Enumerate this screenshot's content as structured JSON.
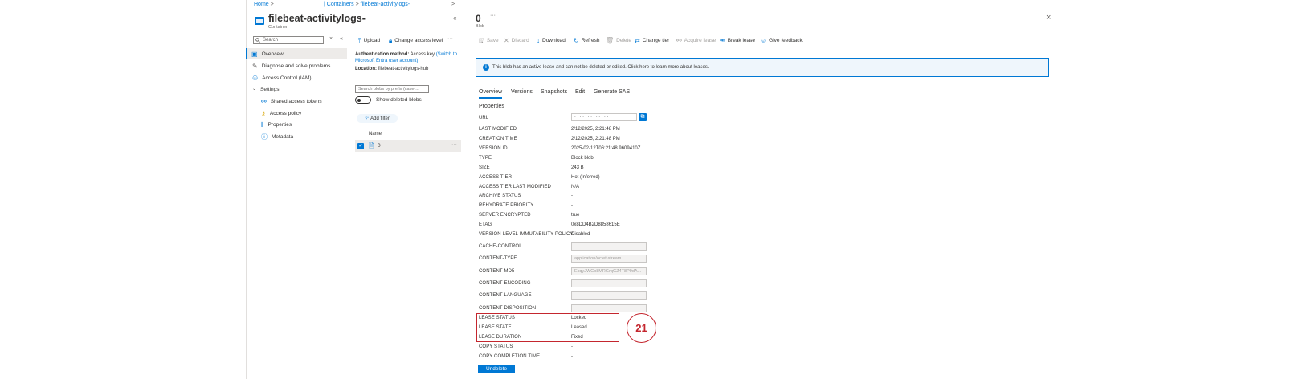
{
  "breadcrumb": {
    "home": "Home",
    "sep1": ">",
    "containers": "| Containers",
    "sep2": ">",
    "current": "filebeat-activitylogs-",
    "sep3": ">"
  },
  "container": {
    "title": "filebeat-activitylogs-",
    "subtitle": "Container",
    "collapse": "«",
    "search_placeholder": "Search",
    "search_clear": "×",
    "search_collapse": "«"
  },
  "left_nav": {
    "overview": "Overview",
    "diagnose": "Diagnose and solve problems",
    "iam": "Access Control (IAM)",
    "settings": "Settings",
    "sas": "Shared access tokens",
    "policy": "Access policy",
    "properties": "Properties",
    "metadata": "Metadata"
  },
  "middle": {
    "upload": "Upload",
    "change_access": "Change access level",
    "more": "···",
    "auth_label": "Authentication method:",
    "auth_value": "Access key",
    "auth_link": "(Switch to Microsoft Entra user account)",
    "location_label": "Location:",
    "location_value": "filebeat-activitylogs-hub",
    "prefix_placeholder": "Search blobs by prefix (case-...",
    "show_deleted": "Show deleted blobs",
    "add_filter": "Add filter",
    "name_header": "Name",
    "row_name": "0",
    "row_more": "···"
  },
  "blob": {
    "title": "0",
    "ellipsis": "···",
    "subtitle": "Blob",
    "close": "×"
  },
  "toolbar": {
    "save": "Save",
    "discard": "Discard",
    "download": "Download",
    "refresh": "Refresh",
    "delete": "Delete",
    "change_tier": "Change tier",
    "acquire_lease": "Acquire lease",
    "break_lease": "Break lease",
    "feedback": "Give feedback"
  },
  "banner": "This blob has an active lease and can not be deleted or edited. Click here to learn more about leases.",
  "tabs": [
    "Overview",
    "Versions",
    "Snapshots",
    "Edit",
    "Generate SAS"
  ],
  "properties": {
    "heading": "Properties",
    "url_label": "URL",
    "url_value": "· · · · · · · · · · · · ·",
    "rows": [
      {
        "label": "LAST MODIFIED",
        "value": "2/12/2025, 2:21:48 PM"
      },
      {
        "label": "CREATION TIME",
        "value": "2/12/2025, 2:21:48 PM"
      },
      {
        "label": "VERSION ID",
        "value": "2025-02-12T06:21:48.9609410Z"
      },
      {
        "label": "TYPE",
        "value": "Block blob"
      },
      {
        "label": "SIZE",
        "value": "243 B"
      },
      {
        "label": "ACCESS TIER",
        "value": "Hot (Inferred)"
      },
      {
        "label": "ACCESS TIER LAST MODIFIED",
        "value": "N/A"
      },
      {
        "label": "ARCHIVE STATUS",
        "value": "-"
      },
      {
        "label": "REHYDRATE PRIORITY",
        "value": "-"
      },
      {
        "label": "SERVER ENCRYPTED",
        "value": "true"
      },
      {
        "label": "ETAG",
        "value": "0x8DD4B2D8858615E"
      },
      {
        "label": "VERSION-LEVEL IMMUTABILITY POLICY",
        "value": "Disabled"
      }
    ],
    "boxes": [
      {
        "label": "CACHE-CONTROL",
        "value": ""
      },
      {
        "label": "CONTENT-TYPE",
        "value": "application/octet-stream"
      },
      {
        "label": "CONTENT-MD5",
        "value": "EcqyJWCb8MRGrqGZ4T8P9dA..."
      },
      {
        "label": "CONTENT-ENCODING",
        "value": ""
      },
      {
        "label": "CONTENT-LANGUAGE",
        "value": ""
      },
      {
        "label": "CONTENT-DISPOSITION",
        "value": ""
      }
    ],
    "lease_rows": [
      {
        "label": "LEASE STATUS",
        "value": "Locked"
      },
      {
        "label": "LEASE STATE",
        "value": "Leased"
      },
      {
        "label": "LEASE DURATION",
        "value": "Fixed"
      }
    ],
    "copy_rows": [
      {
        "label": "COPY STATUS",
        "value": "-"
      },
      {
        "label": "COPY COMPLETION TIME",
        "value": "-"
      }
    ]
  },
  "undelete": "Undelete",
  "annotation": "21",
  "colors": {
    "accent": "#0078d4",
    "highlight": "#c4262e"
  }
}
